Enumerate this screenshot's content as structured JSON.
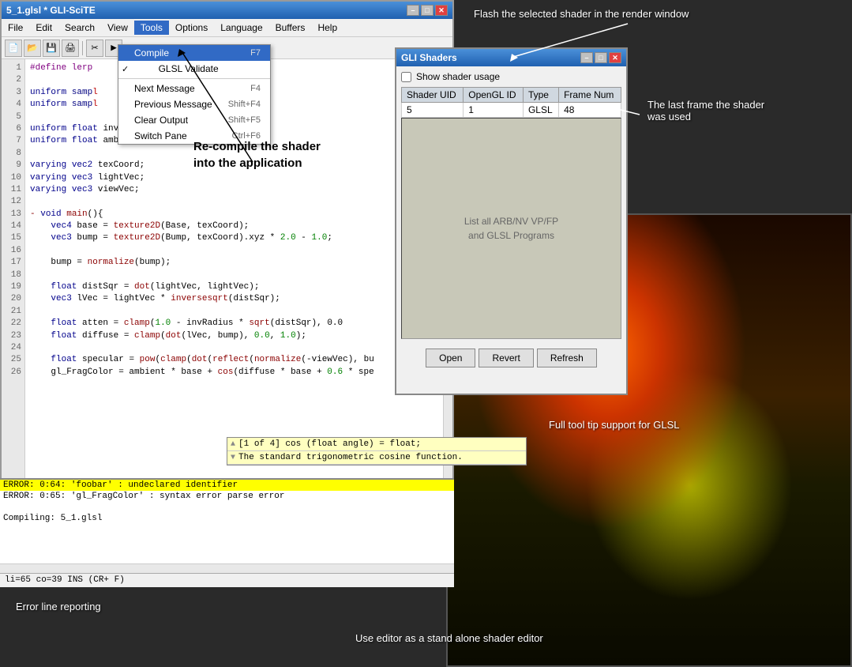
{
  "window": {
    "title": "5_1.glsl * GLI-SciTE",
    "min_label": "–",
    "max_label": "□",
    "close_label": "✕"
  },
  "menubar": {
    "items": [
      "File",
      "Edit",
      "Search",
      "View",
      "Tools",
      "Options",
      "Language",
      "Buffers",
      "Help"
    ]
  },
  "tools_menu": {
    "items": [
      {
        "label": "Compile",
        "shortcut": "F7",
        "highlighted": true,
        "check": false
      },
      {
        "label": "GLSL Validate",
        "shortcut": "",
        "highlighted": false,
        "check": true
      },
      {
        "label": "",
        "sep": true
      },
      {
        "label": "Next Message",
        "shortcut": "F4",
        "highlighted": false,
        "check": false
      },
      {
        "label": "Previous Message",
        "shortcut": "Shift+F4",
        "highlighted": false,
        "check": false
      },
      {
        "label": "Clear Output",
        "shortcut": "Shift+F5",
        "highlighted": false,
        "check": false
      },
      {
        "label": "Switch Pane",
        "shortcut": "Ctrl+F6",
        "highlighted": false,
        "check": false
      }
    ]
  },
  "code": {
    "lines": [
      "#define lerp",
      "",
      "uniform samp",
      "uniform samp",
      "",
      "uniform float invRadius;",
      "uniform float ambient;",
      "",
      "varying vec2 texCoord;",
      "varying vec3 lightVec;",
      "varying vec3 viewVec;",
      "",
      "- void main(){",
      "    vec4 base = texture2D(Base, texCoord);",
      "    vec3 bump = texture2D(Bump, texCoord).xyz * 2.0 - 1.0;",
      "",
      "    bump = normalize(bump);",
      "",
      "    float distSqr = dot(lightVec, lightVec);",
      "    vec3 lVec = lightVec * inversesqrt(distSqr);",
      "",
      "    float atten = clamp(1.0 - invRadius * sqrt(distSqr), 0.0",
      "    float diffuse = clamp(dot(lVec, bump), 0.0, 1.0);",
      "",
      "    float specular = pow(clamp(dot(reflect(normalize(-viewVec), bu",
      "    gl_FragColor = ambient * base + cos(diffuse * base + 0.6 * spe"
    ]
  },
  "tooltip": {
    "row1": "[1 of 4] cos (float angle) = float;",
    "row2": "The standard trigonometric cosine function."
  },
  "output": {
    "lines": [
      {
        "text": "ERROR: 0:64: 'foobar' : undeclared identifier",
        "error": true
      },
      {
        "text": "ERROR: 0:65: 'gl_FragColor' : syntax error parse error",
        "error": false
      },
      {
        "text": "",
        "error": false
      },
      {
        "text": "Compiling: 5_1.glsl",
        "error": false
      }
    ]
  },
  "statusbar": {
    "text": "li=65 co=39 INS (CR+ F)"
  },
  "gli_shaders": {
    "title": "GLI Shaders",
    "show_shader_usage": "Show shader usage",
    "columns": [
      "Shader UID",
      "OpenGL ID",
      "Type",
      "Frame Num"
    ],
    "rows": [
      {
        "uid": "5",
        "opengl_id": "1",
        "type": "GLSL",
        "frame_num": "48"
      }
    ],
    "list_label": "List all ARB/NV VP/FP\nand GLSL Programs",
    "btn_open": "Open",
    "btn_revert": "Revert",
    "btn_refresh": "Refresh"
  },
  "annotations": {
    "flash_shader": "Flash the selected shader in the render window",
    "last_frame": "The last frame the shader\nwas used",
    "list_programs": "List all ARB/NV VP/FP\nand GLSL Programs",
    "recompile": "Re-compile the shader\ninto the application",
    "tooltip_support": "Full tool tip support for GLSL",
    "error_reporting": "Error line reporting",
    "standalone_editor": "Use editor as a stand alone shader editor"
  }
}
